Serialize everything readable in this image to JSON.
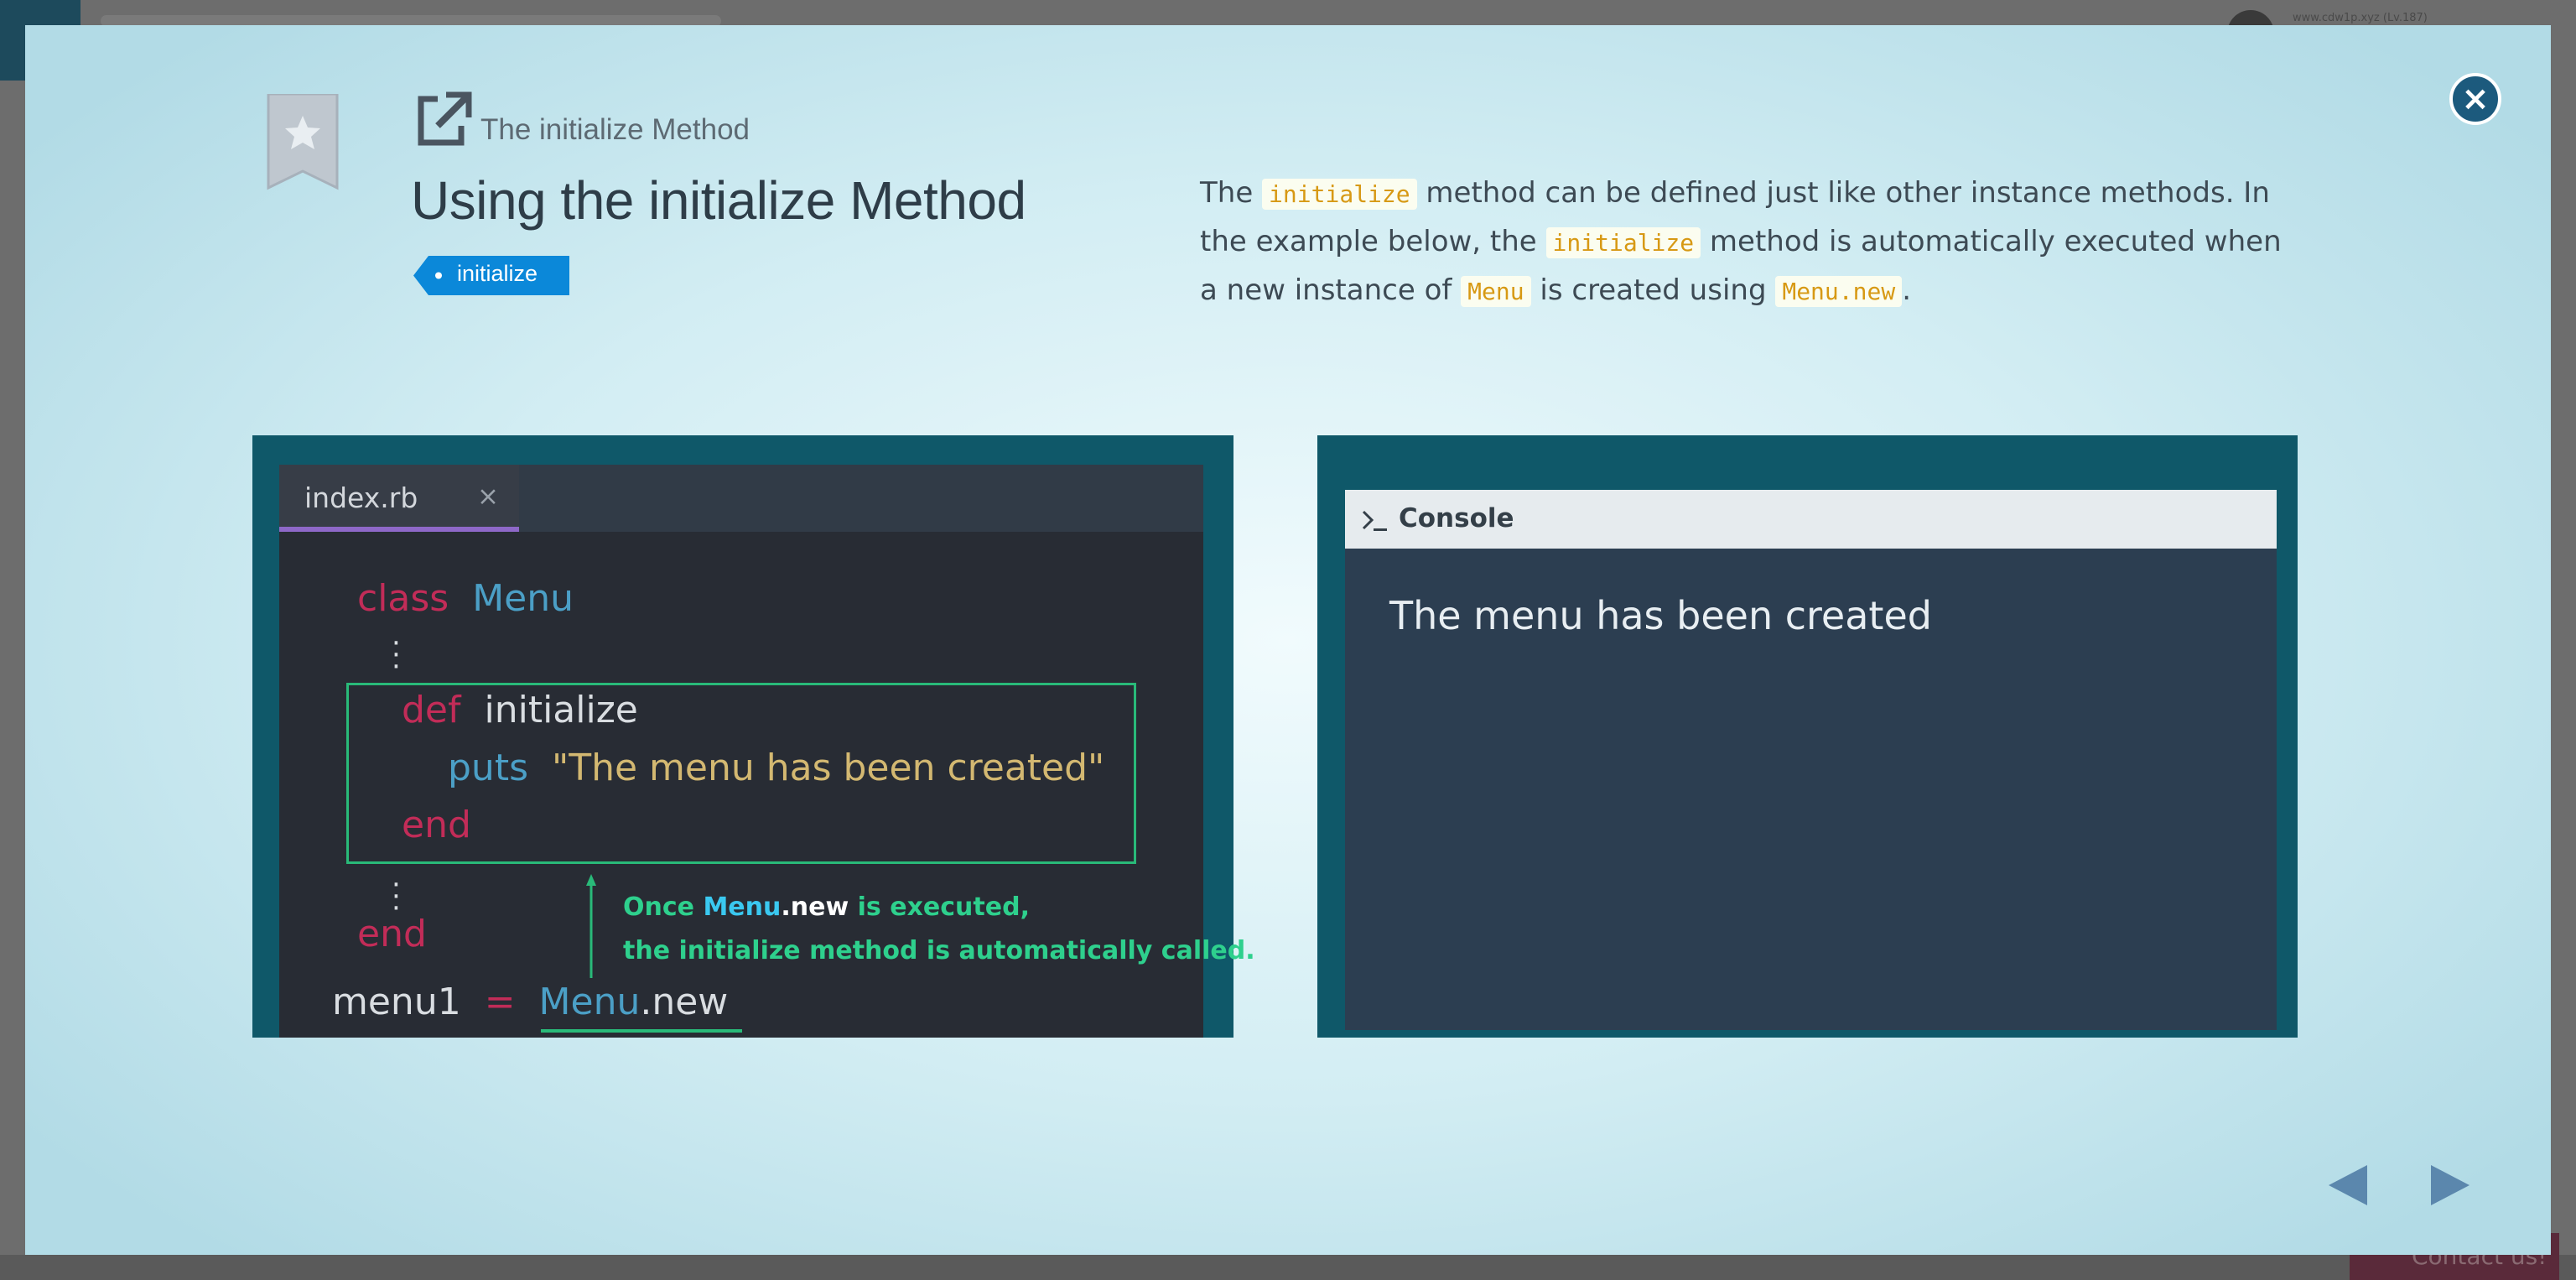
{
  "colors": {
    "accent": "#0b88d9",
    "modal_gradient_center": "#f1fbfd",
    "modal_gradient_edge": "#b2dbe6",
    "panel_frame": "#0f5869",
    "keyword": "#c22c58",
    "constant": "#4b9fc6",
    "string": "#d3b871",
    "highlight": "#29ba79",
    "inline_code": "#d79914"
  },
  "backdrop": {
    "user_label": "www.cdw1p.xyz (Lv.187)",
    "contact_label": "Contact us!"
  },
  "modal": {
    "close_icon": "close-circle-icon",
    "bookmark_icon": "bookmark-star-icon",
    "external_link_icon": "external-link-icon",
    "eyebrow": "The initialize Method",
    "title": "Using the initialize Method",
    "tag_label": "initialize",
    "description": {
      "t1": "The ",
      "c1": "initialize",
      "t2": " method can be defined just like other instance methods. In the example below, the ",
      "c2": "initialize",
      "t3": " method is automatically executed when a new instance of ",
      "c3": "Menu",
      "t4": " is created using ",
      "c4": "Menu.new",
      "t5": "."
    }
  },
  "editor": {
    "tab_label": "index.rb",
    "tab_close": "×",
    "lines": {
      "class_kw": "class",
      "class_name": "Menu",
      "def_kw": "def",
      "method_name": "initialize",
      "puts_kw": "puts",
      "puts_str": "\"The menu has been created\"",
      "end_inner": "end",
      "end_outer": "end",
      "var": "menu1",
      "op": "=",
      "const": "Menu",
      "call": ".new"
    },
    "note": {
      "l1_a": "Once ",
      "l1_b": "Menu",
      "l1_c": ".new",
      "l1_d": " is executed,",
      "l2": "the initialize method is automatically called."
    }
  },
  "console": {
    "icon": "terminal-prompt-icon",
    "title": "Console",
    "output": "The menu has been created"
  },
  "navigation": {
    "prev_icon": "triangle-left-icon",
    "next_icon": "triangle-right-icon"
  }
}
